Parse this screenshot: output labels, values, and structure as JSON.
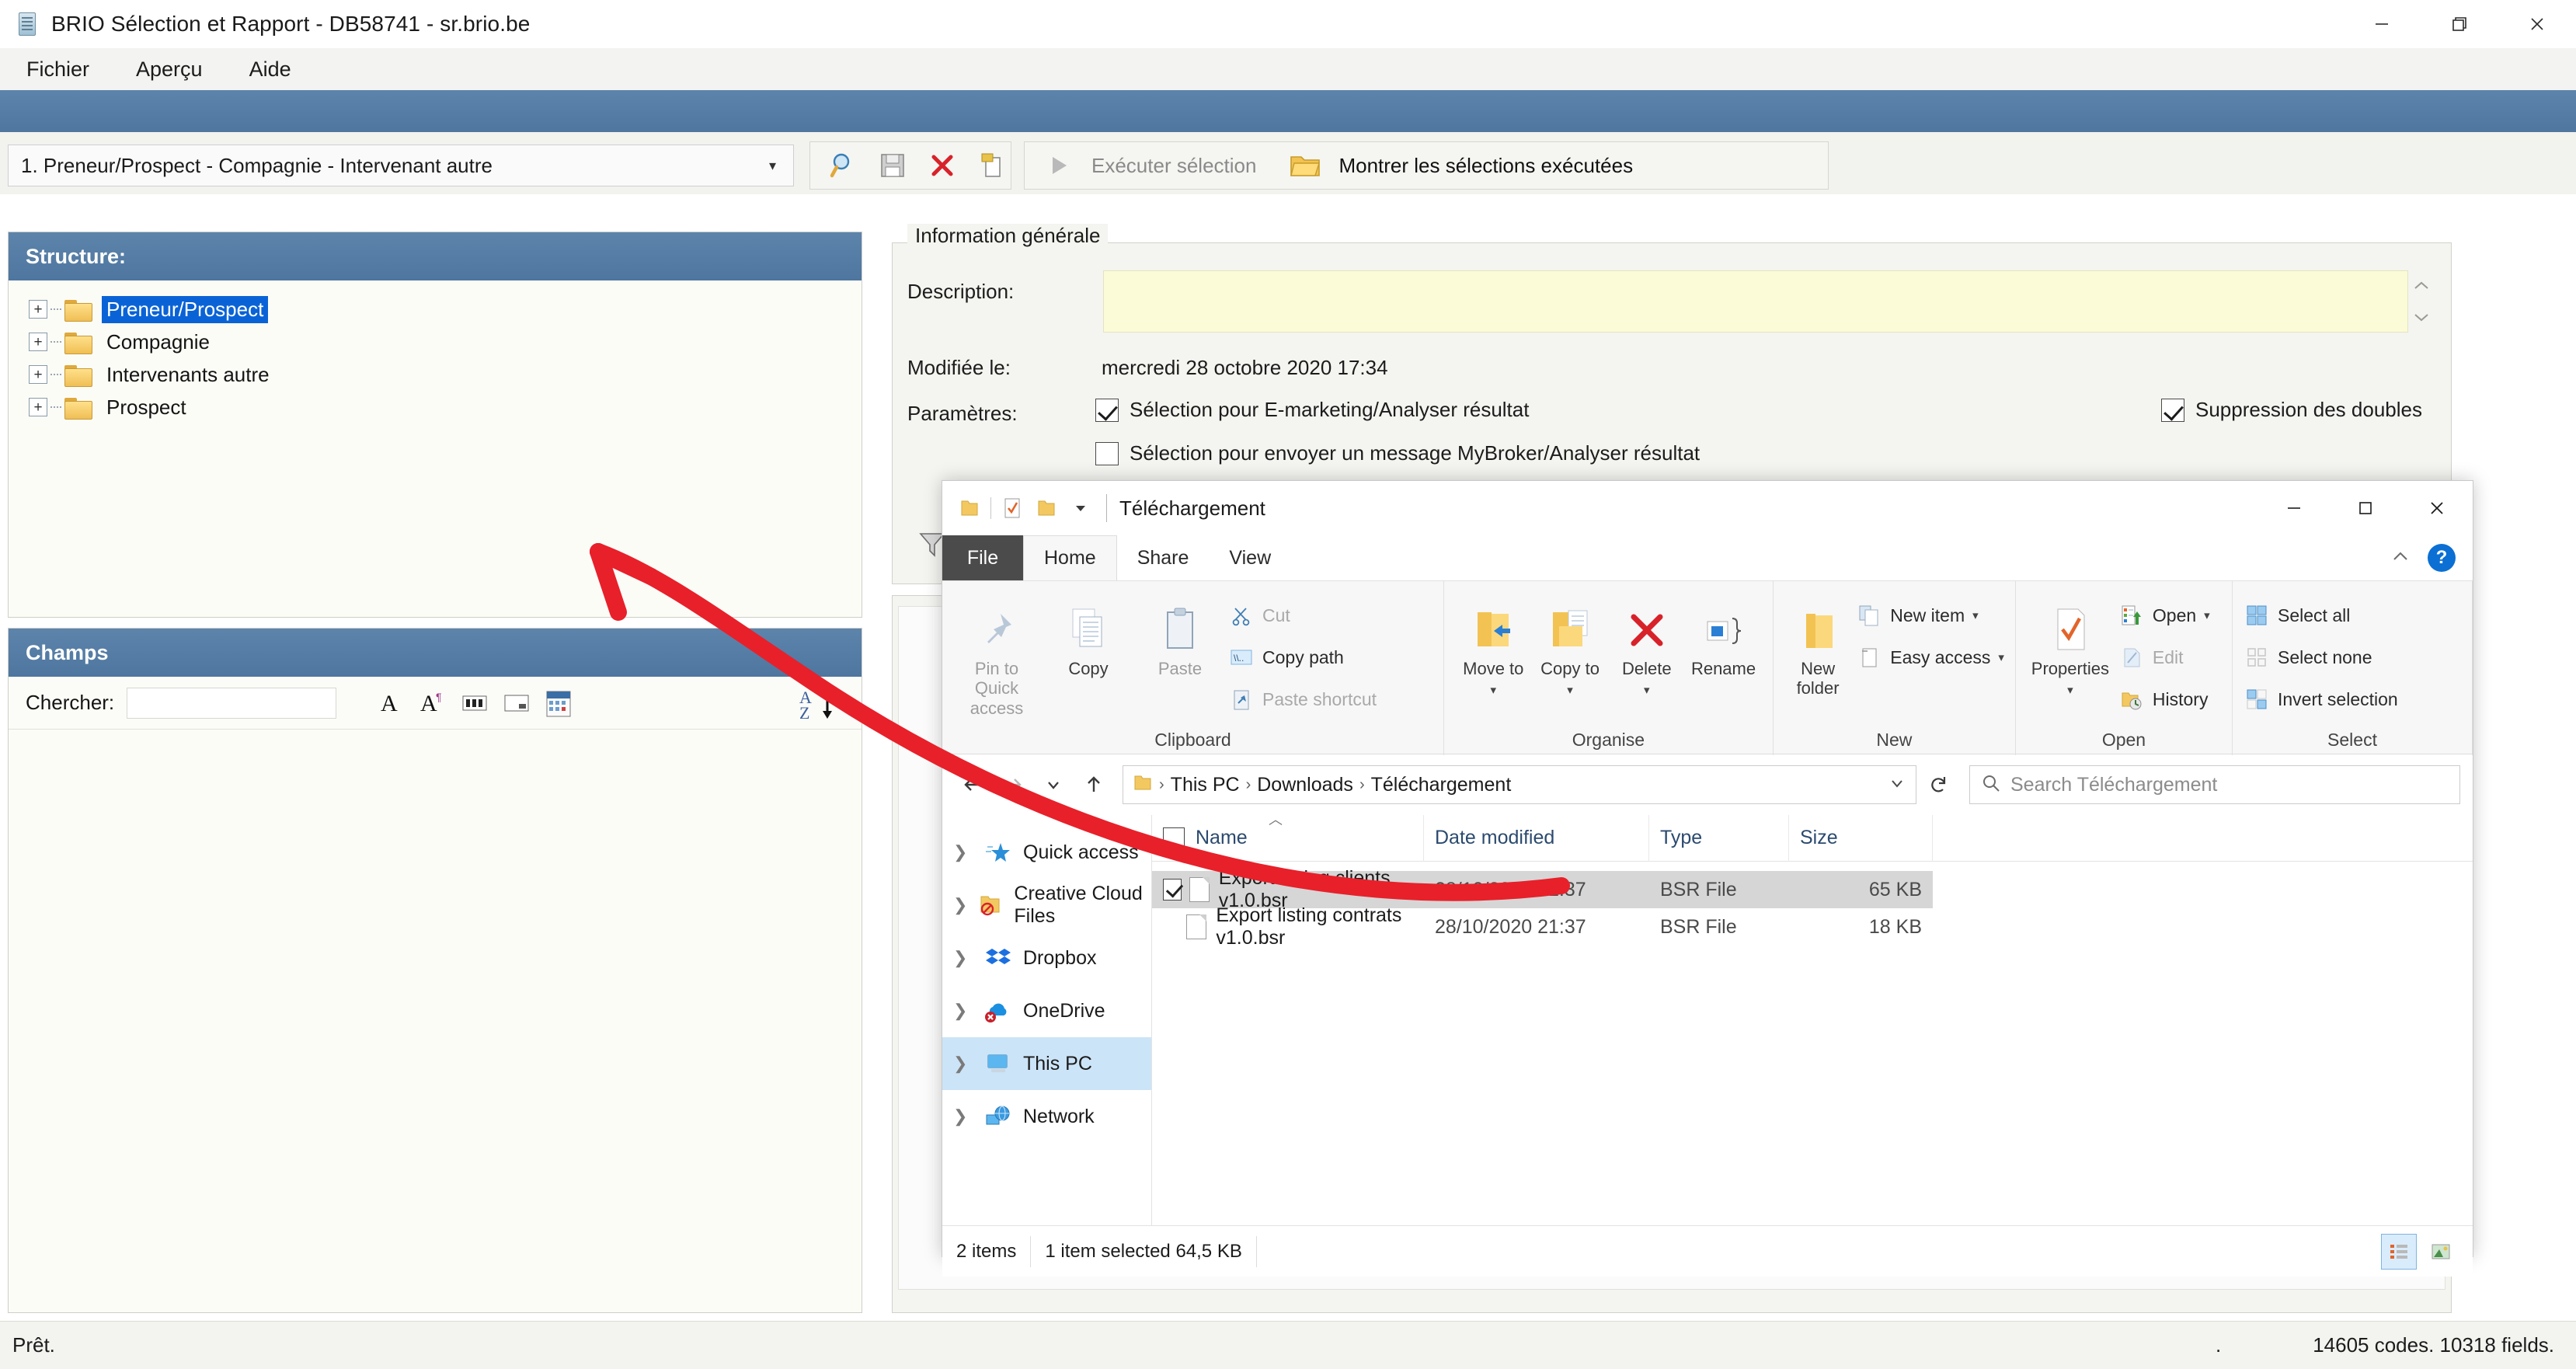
{
  "brio": {
    "title": "BRIO Sélection et Rapport - DB58741 - sr.brio.be",
    "app_icon": "brio-app-icon",
    "window_controls": [
      {
        "name": "minimize-button",
        "glyph": "minimize-icon"
      },
      {
        "name": "restore-button",
        "glyph": "restore-icon"
      },
      {
        "name": "close-button",
        "glyph": "close-icon"
      }
    ],
    "menu": [
      {
        "label": "Fichier"
      },
      {
        "label": "Aperçu"
      },
      {
        "label": "Aide"
      }
    ],
    "toolbar": {
      "selection_combo_value": "1. Preneur/Prospect - Compagnie - Intervenant autre",
      "combo_arrow": "▾",
      "icon_buttons": [
        {
          "name": "search-icon",
          "title": "Chercher"
        },
        {
          "name": "save-icon",
          "title": "Enregistrer"
        },
        {
          "name": "delete-icon",
          "title": "Supprimer"
        },
        {
          "name": "copy-icon",
          "title": "Copier"
        }
      ],
      "run_selection_label": "Exécuter sélection",
      "show_executed_label": "Montrer les sélections exécutées"
    },
    "structure_panel": {
      "header": "Structure:",
      "items": [
        {
          "label": "Preneur/Prospect",
          "selected": true
        },
        {
          "label": "Compagnie",
          "selected": false
        },
        {
          "label": "Intervenants autre",
          "selected": false
        },
        {
          "label": "Prospect",
          "selected": false
        }
      ]
    },
    "champs_panel": {
      "header": "Champs",
      "search_label": "Chercher:",
      "search_value": "",
      "icons": [
        {
          "name": "text-field-icon"
        },
        {
          "name": "text-field-alt-icon"
        },
        {
          "name": "numeric-field-icon"
        },
        {
          "name": "boolean-field-icon"
        },
        {
          "name": "date-field-icon"
        }
      ],
      "sort_icon": "sort-az-descending-icon"
    },
    "info_group": {
      "legend": "Information générale",
      "description_label": "Description:",
      "description_value": "",
      "modified_label": "Modifiée le:",
      "modified_value": "mercredi 28 octobre 2020 17:34",
      "params_label": "Paramètres:",
      "checkboxes": [
        {
          "label": "Sélection pour E-marketing/Analyser résultat",
          "checked": true
        },
        {
          "label": "Suppression des doubles",
          "checked": true
        },
        {
          "label": "Sélection pour envoyer un message MyBroker/Analyser résultat",
          "checked": false
        }
      ]
    },
    "status_bar": {
      "left": "Prêt.",
      "dot": ".",
      "right": "14605 codes.  10318 fields."
    }
  },
  "explorer": {
    "title": "Téléchargement",
    "quick_access_icons": [
      {
        "name": "folder-icon"
      },
      {
        "name": "properties-check-icon"
      },
      {
        "name": "folder-icon"
      },
      {
        "name": "qat-dropdown-icon"
      }
    ],
    "window_controls": [
      {
        "name": "minimize-button",
        "glyph": "−"
      },
      {
        "name": "maximize-button",
        "glyph": "▢"
      },
      {
        "name": "close-button",
        "glyph": "✕"
      }
    ],
    "tabs": [
      {
        "label": "File",
        "kind": "file"
      },
      {
        "label": "Home",
        "active": true
      },
      {
        "label": "Share",
        "active": false
      },
      {
        "label": "View",
        "active": false
      }
    ],
    "ribbon_collapse_icon": "chevron-up-icon",
    "help_label": "?",
    "ribbon_groups": [
      {
        "title": "Clipboard",
        "big_buttons": [
          {
            "label": "Pin to Quick\naccess",
            "icon": "pin-icon",
            "dim": true
          },
          {
            "label": "Copy",
            "icon": "copy-icon",
            "dim": false
          },
          {
            "label": "Paste",
            "icon": "paste-icon",
            "dim": true
          }
        ],
        "small_buttons": [
          {
            "label": "Cut",
            "icon": "scissors-icon",
            "dim": true
          },
          {
            "label": "Copy path",
            "icon": "copy-path-icon",
            "dim": false
          },
          {
            "label": "Paste shortcut",
            "icon": "paste-shortcut-icon",
            "dim": true
          }
        ]
      },
      {
        "title": "Organise",
        "big_buttons": [
          {
            "label": "Move\nto",
            "icon": "move-to-icon",
            "caret": true
          },
          {
            "label": "Copy\nto",
            "icon": "copy-to-icon",
            "caret": true
          },
          {
            "label": "Delete",
            "icon": "delete-icon",
            "caret": true
          },
          {
            "label": "Rename",
            "icon": "rename-icon",
            "caret": false
          }
        ],
        "small_buttons": []
      },
      {
        "title": "New",
        "big_buttons": [
          {
            "label": "New\nfolder",
            "icon": "new-folder-icon",
            "caret": false
          }
        ],
        "small_buttons": [
          {
            "label": "New item",
            "icon": "new-item-icon",
            "caret": true
          },
          {
            "label": "Easy access",
            "icon": "easy-access-icon",
            "caret": true,
            "dim": true
          }
        ]
      },
      {
        "title": "Open",
        "big_buttons": [
          {
            "label": "Properties",
            "icon": "properties-icon",
            "caret": true
          }
        ],
        "small_buttons": [
          {
            "label": "Open",
            "icon": "open-icon",
            "caret": true
          },
          {
            "label": "Edit",
            "icon": "edit-icon",
            "dim": true
          },
          {
            "label": "History",
            "icon": "history-icon"
          }
        ]
      },
      {
        "title": "Select",
        "big_buttons": [],
        "small_buttons": [
          {
            "label": "Select all",
            "icon": "select-all-icon"
          },
          {
            "label": "Select none",
            "icon": "select-none-icon",
            "dim": true
          },
          {
            "label": "Invert selection",
            "icon": "invert-selection-icon"
          }
        ]
      }
    ],
    "address_bar": {
      "back_icon": "arrow-left-icon",
      "forward_icon": "arrow-right-icon",
      "recent_icon": "chevron-down-icon",
      "up_icon": "arrow-up-icon",
      "folder_icon": "folder-icon",
      "breadcrumbs": [
        "This PC",
        "Downloads",
        "Téléchargement"
      ],
      "separator": "›",
      "dropdown_icon": "chevron-down-icon",
      "refresh_icon": "refresh-icon",
      "search_placeholder": "Search Téléchargement",
      "search_icon": "search-icon"
    },
    "nav_pane": [
      {
        "label": "Quick access",
        "icon": "quick-access-star-icon",
        "selected": false
      },
      {
        "label": "Creative Cloud Files",
        "icon": "creative-cloud-folder-icon",
        "selected": false
      },
      {
        "label": "Dropbox",
        "icon": "dropbox-icon",
        "selected": false
      },
      {
        "label": "OneDrive",
        "icon": "onedrive-error-icon",
        "selected": false
      },
      {
        "label": "This PC",
        "icon": "this-pc-icon",
        "selected": true
      },
      {
        "label": "Network",
        "icon": "network-icon",
        "selected": false
      }
    ],
    "file_list": {
      "columns": [
        "Name",
        "Date modified",
        "Type",
        "Size"
      ],
      "sort_column": "Name",
      "sort_direction": "ascending",
      "rows": [
        {
          "name": "Export listing clients v1.0.bsr",
          "date_modified": "28/10/2020 21:37",
          "type": "BSR File",
          "size": "65 KB",
          "selected": true,
          "checked": true
        },
        {
          "name": "Export listing contrats v1.0.bsr",
          "date_modified": "28/10/2020 21:37",
          "type": "BSR File",
          "size": "18 KB",
          "selected": false,
          "checked": false
        }
      ]
    },
    "status_bar": {
      "items_count": "2 items",
      "selection_info": "1 item selected  64,5 KB",
      "view_buttons": [
        {
          "name": "details-view-button",
          "active": true
        },
        {
          "name": "large-icons-view-button",
          "active": false
        }
      ]
    }
  },
  "annotation": {
    "type": "red-arrow",
    "color": "#e8202a",
    "points_from": "explorer-file-row",
    "points_to": "champs-panel-top"
  }
}
